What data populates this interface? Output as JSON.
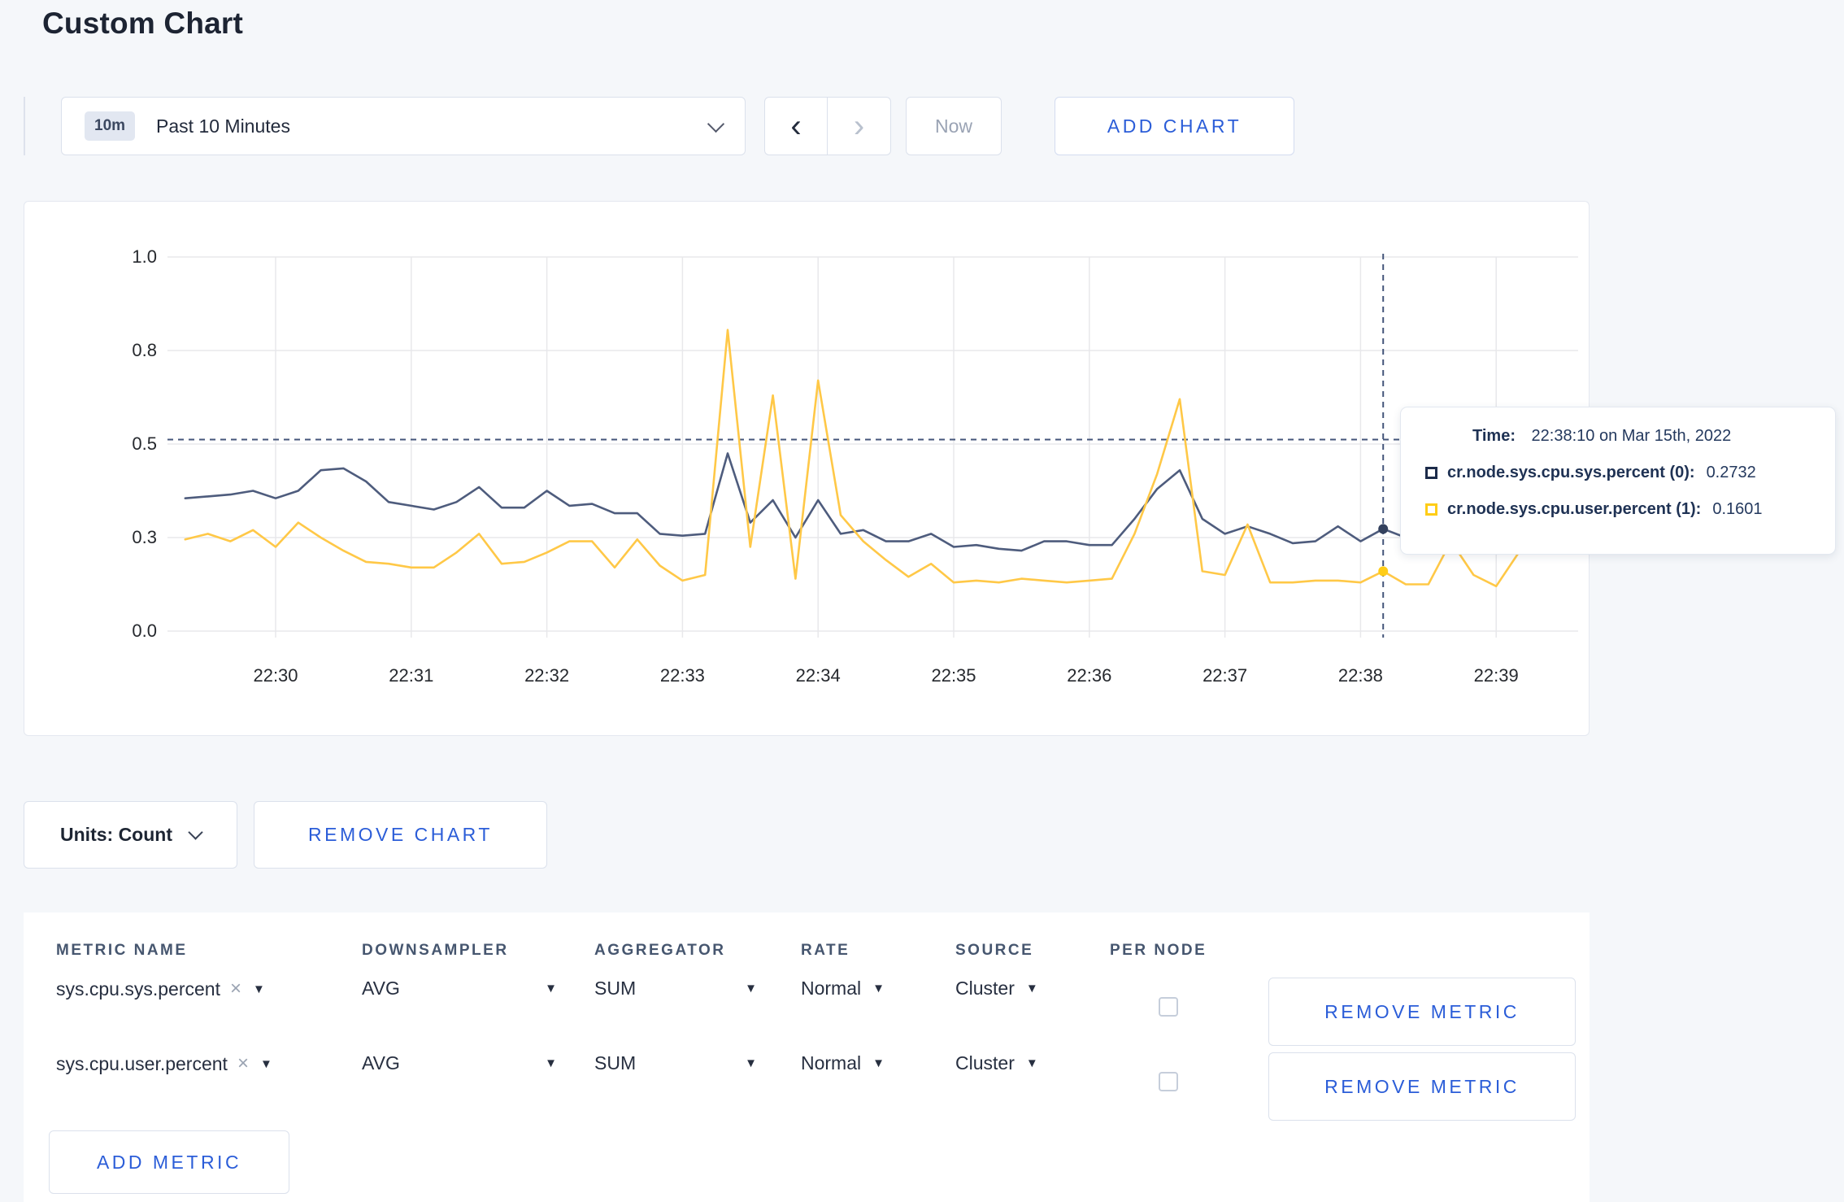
{
  "page": {
    "title": "Custom Chart"
  },
  "toolbar": {
    "time_range": {
      "badge": "10m",
      "label": "Past 10 Minutes"
    },
    "prev_label": "‹",
    "next_label": "›",
    "now_label": "Now",
    "add_chart_label": "ADD CHART"
  },
  "chart_data": {
    "type": "line",
    "title": "",
    "xlabel": "",
    "ylabel": "",
    "ylim": [
      0,
      1
    ],
    "grid": true,
    "x_ticks": [
      "22:30",
      "22:31",
      "22:32",
      "22:33",
      "22:34",
      "22:35",
      "22:36",
      "22:37",
      "22:38",
      "22:39"
    ],
    "y_ticks": {
      "labels": [
        "0.0",
        "0.3",
        "0.5",
        "0.8",
        "1.0"
      ],
      "values": [
        0,
        0.25,
        0.5,
        0.75,
        1.0
      ]
    },
    "x_start_min": -0.6667,
    "x_step_min": 0.16667,
    "series": [
      {
        "name": "cr.node.sys.cpu.sys.percent (0)",
        "color": "#4e5c7d",
        "values": [
          0.355,
          0.36,
          0.365,
          0.375,
          0.355,
          0.375,
          0.43,
          0.435,
          0.4,
          0.345,
          0.335,
          0.325,
          0.345,
          0.385,
          0.33,
          0.33,
          0.375,
          0.335,
          0.34,
          0.315,
          0.315,
          0.26,
          0.255,
          0.26,
          0.475,
          0.29,
          0.35,
          0.25,
          0.35,
          0.26,
          0.27,
          0.24,
          0.24,
          0.26,
          0.225,
          0.23,
          0.22,
          0.215,
          0.24,
          0.24,
          0.23,
          0.23,
          0.3,
          0.38,
          0.43,
          0.3,
          0.26,
          0.28,
          0.26,
          0.235,
          0.24,
          0.28,
          0.24,
          0.2732,
          0.25,
          0.3,
          0.32,
          0.295,
          0.3,
          0.305
        ]
      },
      {
        "name": "cr.node.sys.cpu.user.percent (1)",
        "color": "#ffc847",
        "values": [
          0.245,
          0.26,
          0.24,
          0.27,
          0.225,
          0.29,
          0.25,
          0.215,
          0.185,
          0.18,
          0.17,
          0.17,
          0.21,
          0.26,
          0.18,
          0.185,
          0.21,
          0.24,
          0.24,
          0.17,
          0.245,
          0.175,
          0.135,
          0.15,
          0.805,
          0.225,
          0.63,
          0.14,
          0.67,
          0.31,
          0.24,
          0.19,
          0.145,
          0.18,
          0.13,
          0.135,
          0.13,
          0.14,
          0.135,
          0.13,
          0.135,
          0.14,
          0.26,
          0.42,
          0.62,
          0.16,
          0.15,
          0.285,
          0.13,
          0.13,
          0.135,
          0.135,
          0.13,
          0.1601,
          0.125,
          0.125,
          0.24,
          0.15,
          0.12,
          0.21
        ]
      }
    ],
    "crosshair": {
      "x_min": 8.1667,
      "y_value": 0.512
    },
    "highlight_points": [
      {
        "series": 0,
        "x_min": 8.1667,
        "value": 0.2732,
        "color": "#33415e"
      },
      {
        "series": 1,
        "x_min": 8.1667,
        "value": 0.1601,
        "color": "#ffcd17"
      }
    ]
  },
  "tooltip": {
    "time_label": "Time:",
    "time_value": "22:38:10 on Mar 15th, 2022",
    "rows": [
      {
        "label": "cr.node.sys.cpu.sys.percent (0):",
        "value": "0.2732",
        "swatch": "#1c2b4a"
      },
      {
        "label": "cr.node.sys.cpu.user.percent (1):",
        "value": "0.1601",
        "swatch": "#ffcd17"
      }
    ]
  },
  "chart_controls": {
    "units_label": "Units: Count",
    "remove_chart_label": "REMOVE CHART"
  },
  "metrics_table": {
    "headers": [
      "METRIC NAME",
      "DOWNSAMPLER",
      "AGGREGATOR",
      "RATE",
      "SOURCE",
      "PER NODE"
    ],
    "rows": [
      {
        "metric": "sys.cpu.sys.percent",
        "remove_icon": "×",
        "downsampler": "AVG",
        "aggregator": "SUM",
        "rate": "Normal",
        "source": "Cluster",
        "per_node_checked": false,
        "remove_label": "REMOVE METRIC"
      },
      {
        "metric": "sys.cpu.user.percent",
        "remove_icon": "×",
        "downsampler": "AVG",
        "aggregator": "SUM",
        "rate": "Normal",
        "source": "Cluster",
        "per_node_checked": false,
        "remove_label": "REMOVE METRIC"
      }
    ],
    "add_metric_label": "ADD METRIC",
    "caret_glyph": "▼"
  }
}
